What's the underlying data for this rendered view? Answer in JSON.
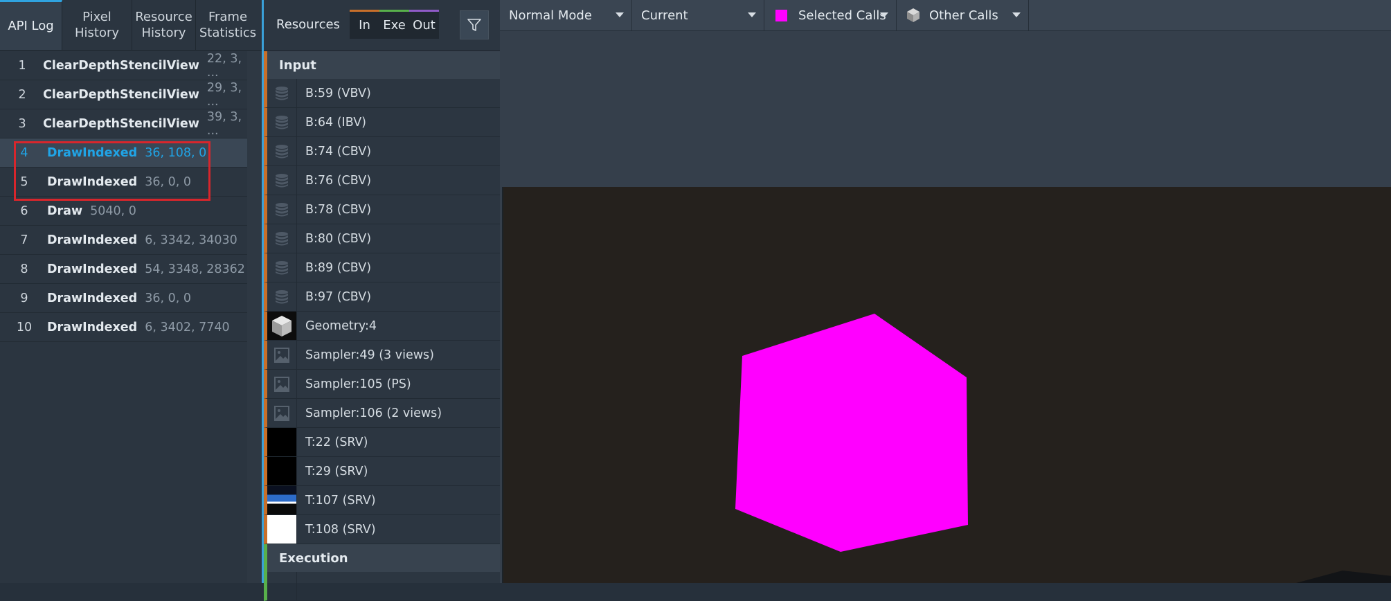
{
  "left_tabs": [
    {
      "label": "API Log"
    },
    {
      "label": "Pixel\nHistory"
    },
    {
      "label": "Resource\nHistory"
    },
    {
      "label": "Frame\nStatistics"
    }
  ],
  "api_calls": [
    {
      "num": "1",
      "fn": "ClearDepthStencilView",
      "args": "22, 3, ..."
    },
    {
      "num": "2",
      "fn": "ClearDepthStencilView",
      "args": "29, 3, ..."
    },
    {
      "num": "3",
      "fn": "ClearDepthStencilView",
      "args": "39, 3, ..."
    },
    {
      "num": "4",
      "fn": "DrawIndexed",
      "args": "36, 108, 0"
    },
    {
      "num": "5",
      "fn": "DrawIndexed",
      "args": "36, 0, 0"
    },
    {
      "num": "6",
      "fn": "Draw",
      "args": "5040, 0"
    },
    {
      "num": "7",
      "fn": "DrawIndexed",
      "args": "6, 3342, 34030"
    },
    {
      "num": "8",
      "fn": "DrawIndexed",
      "args": "54, 3348, 28362"
    },
    {
      "num": "9",
      "fn": "DrawIndexed",
      "args": "36, 0, 0"
    },
    {
      "num": "10",
      "fn": "DrawIndexed",
      "args": "6, 3402, 7740"
    }
  ],
  "resources": {
    "title": "Resources",
    "seg_in": "In",
    "seg_exe": "Exe",
    "seg_out": "Out",
    "input_header": "Input",
    "execution_header": "Execution",
    "items": [
      {
        "label": "B:59 (VBV)",
        "icon": "buffer"
      },
      {
        "label": "B:64 (IBV)",
        "icon": "buffer"
      },
      {
        "label": "B:74 (CBV)",
        "icon": "buffer"
      },
      {
        "label": "B:76 (CBV)",
        "icon": "buffer"
      },
      {
        "label": "B:78 (CBV)",
        "icon": "buffer"
      },
      {
        "label": "B:80 (CBV)",
        "icon": "buffer"
      },
      {
        "label": "B:89 (CBV)",
        "icon": "buffer"
      },
      {
        "label": "B:97 (CBV)",
        "icon": "buffer"
      },
      {
        "label": "Geometry:4",
        "icon": "geometry"
      },
      {
        "label": "Sampler:49 (3 views)",
        "icon": "sampler"
      },
      {
        "label": "Sampler:105 (PS)",
        "icon": "sampler"
      },
      {
        "label": "Sampler:106 (2 views)",
        "icon": "sampler"
      },
      {
        "label": "T:22 (SRV)",
        "icon": "black"
      },
      {
        "label": "T:29 (SRV)",
        "icon": "black"
      },
      {
        "label": "T:107 (SRV)",
        "icon": "blue"
      },
      {
        "label": "T:108 (SRV)",
        "icon": "white"
      }
    ]
  },
  "viewport_toolbar": {
    "mode": "Normal Mode",
    "target": "Current",
    "selected_calls": "Selected Calls",
    "other_calls": "Other Calls"
  },
  "colors": {
    "accent": "#2fa3e0",
    "highlight_box": "#d8262c",
    "selected_calls_swatch": "#ff00ff",
    "input_color": "#c76f2a",
    "exe_color": "#58b04b",
    "out_color": "#8f5bc7"
  }
}
